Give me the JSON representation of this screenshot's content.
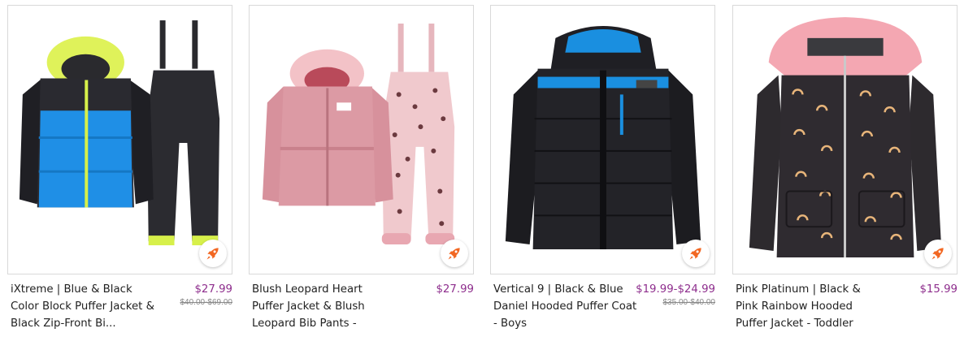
{
  "colors": {
    "price": "#8e2e8d",
    "rocket": "#f26722",
    "border": "#d9d9d9"
  },
  "products": [
    {
      "image": "blue-black-puffer-jacket-and-bib-pants-image",
      "title": "iXtreme | Blue & Black Color Block Puffer Jacket & Black Zip-Front Bi...",
      "price": "$27.99",
      "original_price": "$40.00-$69.00",
      "badge_icon": "rocket-icon"
    },
    {
      "image": "blush-puffer-jacket-and-leopard-bib-pants-image",
      "title": "Blush Leopard Heart Puffer Jacket & Blush Leopard Bib Pants -",
      "price": "$27.99",
      "original_price": "",
      "badge_icon": "rocket-icon"
    },
    {
      "image": "black-blue-hooded-puffer-coat-image",
      "title": "Vertical 9 | Black & Blue Daniel Hooded Puffer Coat - Boys",
      "price": "$19.99-$24.99",
      "original_price": "$35.00-$40.00",
      "badge_icon": "rocket-icon"
    },
    {
      "image": "black-pink-rainbow-puffer-jacket-image",
      "title": "Pink Platinum | Black & Pink Rainbow Hooded Puffer Jacket - Toddler",
      "price": "$15.99",
      "original_price": "",
      "badge_icon": "rocket-icon"
    }
  ]
}
